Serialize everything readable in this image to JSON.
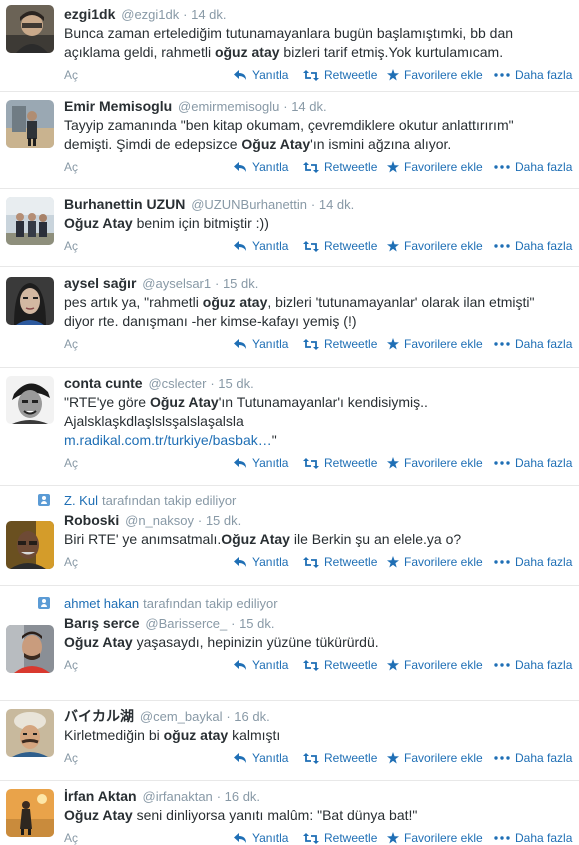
{
  "actions": {
    "expand": "Aç",
    "reply": "Yanıtla",
    "retweet": "Retweetle",
    "favorite": "Favorilere ekle",
    "more": "Daha fazla"
  },
  "colors": {
    "link": "#1f6fb5",
    "muted": "#8899a6",
    "text": "#292f33",
    "divider": "#e8e8e8"
  },
  "icons": {
    "reply": "reply-icon",
    "retweet": "retweet-icon",
    "favorite": "star-icon",
    "more": "more-dots-icon",
    "follow_context": "person-icon"
  },
  "tweets": [
    {
      "fullname": "ezgi1dk",
      "username": "@ezgi1dk",
      "time": "· 14 dk.",
      "lines": [
        [
          {
            "t": "Bunca zaman ertelediğim tutunamayanlara bugün başlamıştımki, bb dan"
          }
        ],
        [
          {
            "t": "açıklama geldi, rahmetli "
          },
          {
            "t": "oğuz atay",
            "b": true
          },
          {
            "t": " bizleri tarif etmiş.Yok kurtulamıcam."
          }
        ]
      ]
    },
    {
      "fullname": "Emir Memisoglu",
      "username": "@emirmemisoglu",
      "time": "· 14 dk.",
      "lines": [
        [
          {
            "t": "Tayyip zamanında \"ben kitap okumam, çevremdiklere okutur anlattırırım\""
          }
        ],
        [
          {
            "t": "demişti. Şimdi de edepsizce "
          },
          {
            "t": "Oğuz Atay",
            "b": true
          },
          {
            "t": "'ın ismini ağzına alıyor."
          }
        ]
      ]
    },
    {
      "fullname": "Burhanettin UZUN",
      "username": "@UZUNBurhanettin",
      "time": "· 14 dk.",
      "lines": [
        [
          {
            "t": "Oğuz Atay",
            "b": true
          },
          {
            "t": " benim için bitmiştir :))"
          }
        ]
      ]
    },
    {
      "fullname": "aysel sağır",
      "username": "@ayselsar1",
      "time": "· 15 dk.",
      "lines": [
        [
          {
            "t": "pes artık ya, \"rahmetli "
          },
          {
            "t": "oğuz atay",
            "b": true
          },
          {
            "t": ", bizleri 'tutunamayanlar' olarak ilan etmişti\""
          }
        ],
        [
          {
            "t": "diyor rte. danışmanı -her kimse-kafayı yemiş (!)"
          }
        ]
      ]
    },
    {
      "fullname": "conta cunte",
      "username": "@cslecter",
      "time": "· 15 dk.",
      "lines": [
        [
          {
            "t": "\"RTE'ye göre "
          },
          {
            "t": "Oğuz Atay",
            "b": true
          },
          {
            "t": "'ın Tutunamayanlar'ı kendisiymiş.."
          }
        ],
        [
          {
            "t": "Ajalsklaşkdlaşlslsşalslaşalsla"
          }
        ],
        [
          {
            "t": "m.radikal.com.tr/turkiye/basbak…",
            "link": true
          },
          {
            "t": "\""
          }
        ]
      ]
    },
    {
      "context": {
        "name": "Z. Kul",
        "suffix": "tarafından takip ediliyor"
      },
      "fullname": "Roboski",
      "username": "@n_naksoy",
      "time": "· 15 dk.",
      "lines": [
        [
          {
            "t": "Biri RTE' ye anımsatmalı."
          },
          {
            "t": "Oğuz Atay",
            "b": true
          },
          {
            "t": " ile Berkin şu  an elele.ya o?"
          }
        ]
      ]
    },
    {
      "context": {
        "name": "ahmet hakan",
        "suffix": "tarafından takip ediliyor"
      },
      "fullname": "Barış serce",
      "username": "@Barisserce_",
      "time": "· 15 dk.",
      "lines": [
        [
          {
            "t": "Oğuz Atay",
            "b": true
          },
          {
            "t": " yaşasaydı, hepinizin yüzüne tükürürdü."
          }
        ]
      ]
    },
    {
      "fullname": "バイカル湖",
      "username": "@cem_baykal",
      "time": "· 16 dk.",
      "lines": [
        [
          {
            "t": "Kirletmediğin bi "
          },
          {
            "t": "oğuz atay",
            "b": true
          },
          {
            "t": " kalmıştı"
          }
        ]
      ]
    },
    {
      "fullname": "İrfan Aktan",
      "username": "@irfanaktan",
      "time": "· 16 dk.",
      "lines": [
        [
          {
            "t": "Oğuz Atay",
            "b": true
          },
          {
            "t": " seni dinliyorsa yanıtı malûm: \"Bat dünya bat!\""
          }
        ]
      ]
    }
  ]
}
